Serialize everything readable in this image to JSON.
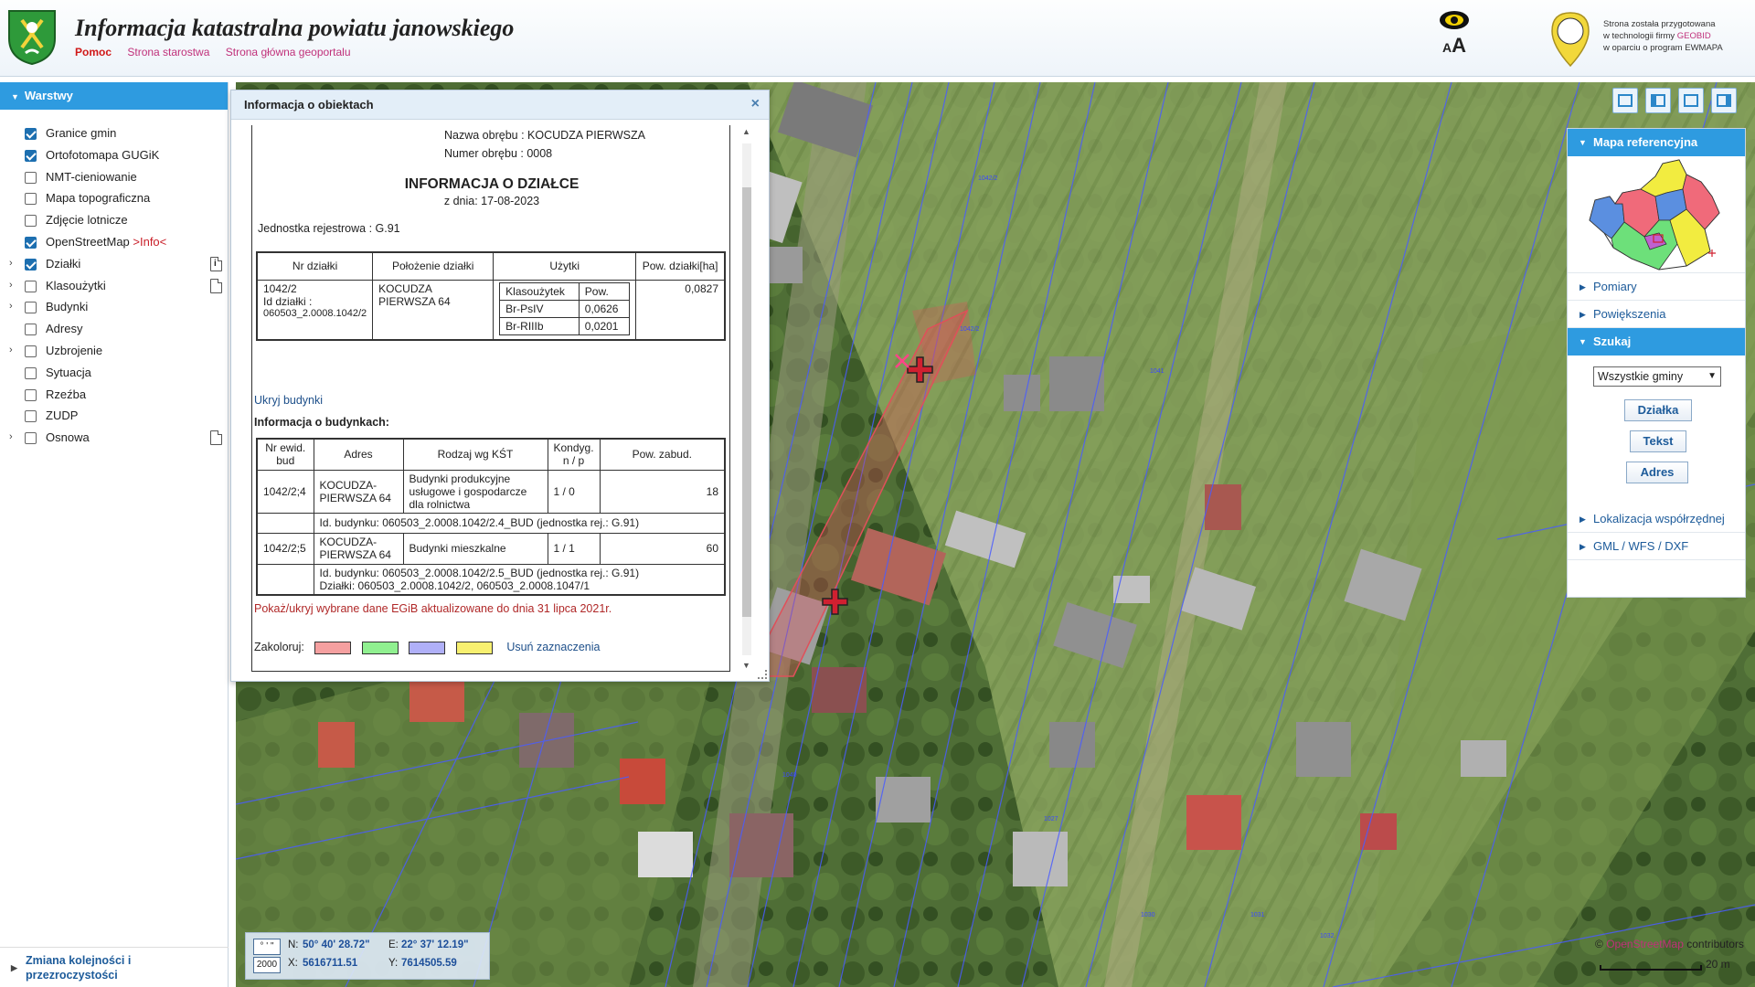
{
  "header": {
    "title": "Informacja katastralna powiatu janowskiego",
    "links": [
      "Pomoc",
      "Strona starostwa",
      "Strona główna geoportalu"
    ],
    "font_toggle": "AA",
    "geobid_text_1": "Strona została przygotowana",
    "geobid_text_2a": "w technologii firmy ",
    "geobid_brand": "GEOBID",
    "geobid_text_3": "w oparciu o program EWMAPA",
    "geobid_logo_text": "GEOBID"
  },
  "layers": {
    "title": "Warstwy",
    "items": [
      {
        "label": "Granice gmin",
        "checked": true,
        "expandable": false,
        "doc": ""
      },
      {
        "label": "Ortofotomapa GUGiK",
        "checked": true,
        "expandable": false,
        "doc": ""
      },
      {
        "label": "NMT-cieniowanie",
        "checked": false,
        "expandable": false,
        "doc": ""
      },
      {
        "label": "Mapa topograficzna",
        "checked": false,
        "expandable": false,
        "doc": ""
      },
      {
        "label": "Zdjęcie lotnicze",
        "checked": false,
        "expandable": false,
        "doc": ""
      },
      {
        "label": "OpenStreetMap ",
        "info": ">Info<",
        "checked": true,
        "expandable": false,
        "doc": ""
      },
      {
        "label": "Działki",
        "checked": true,
        "expandable": true,
        "doc": "info"
      },
      {
        "label": "Klasoużytki",
        "checked": false,
        "expandable": true,
        "doc": "doc"
      },
      {
        "label": "Budynki",
        "checked": false,
        "expandable": true,
        "doc": ""
      },
      {
        "label": "Adresy",
        "checked": false,
        "expandable": false,
        "doc": ""
      },
      {
        "label": "Uzbrojenie",
        "checked": false,
        "expandable": true,
        "doc": ""
      },
      {
        "label": "Sytuacja",
        "checked": false,
        "expandable": false,
        "doc": ""
      },
      {
        "label": "Rzeźba",
        "checked": false,
        "expandable": false,
        "doc": ""
      },
      {
        "label": "ZUDP",
        "checked": false,
        "expandable": false,
        "doc": ""
      },
      {
        "label": "Osnowa",
        "checked": false,
        "expandable": true,
        "doc": "doc"
      }
    ],
    "order_link_1": "Zmiana kolejności i",
    "order_link_2": "przezroczystości"
  },
  "info_window": {
    "title": "Informacja o obiektach",
    "close": "×",
    "obreb_name": "Nazwa obrębu : KOCUDZA PIERWSZA",
    "obreb_number": "Numer obrębu : 0008",
    "heading": "INFORMACJA O DZIAŁCE",
    "date": "z dnia: 17-08-2023",
    "jednostka": "Jednostka rejestrowa : G.91",
    "parcel_headers": [
      "Nr działki",
      "Położenie działki",
      "Użytki",
      "Pow. działki[ha]"
    ],
    "parcel": {
      "nr": "1042/2",
      "id_label": "Id działki :",
      "id": "060503_2.0008.1042/2",
      "polozenie_1": "KOCUDZA",
      "polozenie_2": "PIERWSZA 64",
      "pow": "0,0827",
      "uzytki_head": [
        "Klasoużytek",
        "Pow."
      ],
      "uzytki": [
        {
          "k": "Br-PsIV",
          "p": "0,0626"
        },
        {
          "k": "Br-RIIIb",
          "p": "0,0201"
        }
      ]
    },
    "hide_buildings": "Ukryj budynki",
    "buildings_heading": "Informacja o budynkach:",
    "bud_headers": [
      "Nr ewid. bud",
      "Adres",
      "Rodzaj wg KŚT",
      "Kondyg. n / p",
      "Pow. zabud."
    ],
    "buildings": [
      {
        "nr": "1042/2;4",
        "adres_1": "KOCUDZA-",
        "adres_2": "PIERWSZA 64",
        "rodzaj": "Budynki produkcyjne usługowe i gospodarcze dla rolnictwa",
        "kond": "1 / 0",
        "pow": "18",
        "id_line": "Id. budynku:   060503_2.0008.1042/2.4_BUD   (jednostka rej.: G.91)",
        "dzialki_line": ""
      },
      {
        "nr": "1042/2;5",
        "adres_1": "KOCUDZA-",
        "adres_2": "PIERWSZA 64",
        "rodzaj": "Budynki mieszkalne",
        "kond": "1 / 1",
        "pow": "60",
        "id_line": "Id. budynku:   060503_2.0008.1042/2.5_BUD   (jednostka rej.: G.91)",
        "dzialki_line": "Działki:   060503_2.0008.1042/2, 060503_2.0008.1047/1"
      }
    ],
    "egib_link": "Pokaż/ukryj wybrane dane EGiB aktualizowane do dnia 31 lipca 2021r.",
    "colorize_label": "Zakoloruj:",
    "swatches": [
      "#f5a0a0",
      "#90f090",
      "#b0b0f8",
      "#f8f070"
    ],
    "clear_selection": "Usuń zaznaczenia"
  },
  "right_panel": {
    "ref_map_title": "Mapa referencyjna",
    "pomiary": "Pomiary",
    "powiekszenia": "Powiększenia",
    "szukaj": "Szukaj",
    "gmina_select": "Wszystkie gminy",
    "btn_dzialka": "Działka",
    "btn_tekst": "Tekst",
    "btn_adres": "Adres",
    "lokalizacja": "Lokalizacja współrzędnej",
    "gml": "GML / WFS / DXF"
  },
  "coords": {
    "btn1": "° ' \"",
    "btn2": "2000",
    "n_label": "N:",
    "n_value": "50° 40' 28.72\"",
    "e_label": "E:",
    "e_value": "22° 37' 12.19\"",
    "x_label": "X:",
    "x_value": "5616711.51",
    "y_label": "Y:",
    "y_value": "7614505.59"
  },
  "attribution": {
    "copy": "© ",
    "osm": "OpenStreetMap",
    "contributors": " contributors"
  },
  "scale": "20 m",
  "map_labels": [
    "1042/2",
    "1042/2",
    "1041",
    "1040",
    "1027",
    "1030",
    "1031",
    "1032"
  ],
  "colors": {
    "accent": "#2e9be0",
    "link": "#1d5b9a",
    "highlight_parcel": "#e0505a"
  }
}
